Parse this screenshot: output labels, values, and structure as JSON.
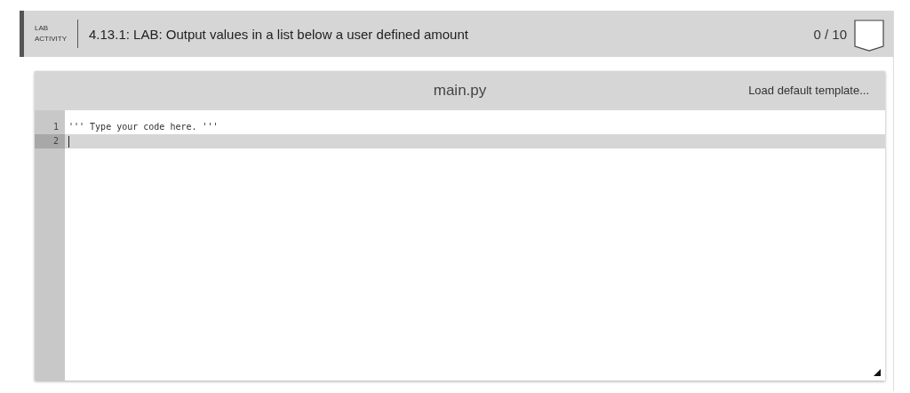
{
  "header": {
    "label_lines": [
      "LAB",
      "ACTIVITY"
    ],
    "title": "4.13.1: LAB: Output values in a list below a user defined amount",
    "score": "0 / 10"
  },
  "editor": {
    "filename": "main.py",
    "template_button": "Load default template...",
    "lines": [
      {
        "number": "1",
        "text": "''' Type your code here. '''",
        "active": false
      },
      {
        "number": "2",
        "active": true
      }
    ]
  }
}
